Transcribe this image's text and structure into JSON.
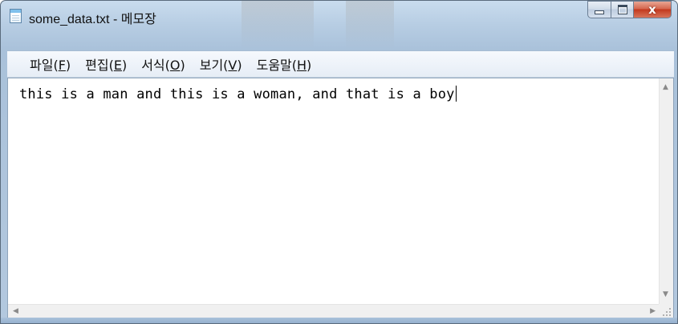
{
  "window": {
    "title": "some_data.txt - 메모장",
    "icon": "notepad-icon",
    "caption_buttons": {
      "minimize_icon": "minimize-icon",
      "maximize_icon": "maximize-icon",
      "close_glyph": "x"
    }
  },
  "menu": {
    "items": [
      {
        "label": "파일(F)"
      },
      {
        "label": "편집(E)"
      },
      {
        "label": "서식(O)"
      },
      {
        "label": "보기(V)"
      },
      {
        "label": "도움말(H)"
      }
    ]
  },
  "editor": {
    "content": "this is a man and this is a woman, and that is a boy"
  },
  "scrollbars": {
    "up_arrow": "▲",
    "down_arrow": "▼",
    "left_arrow": "◀",
    "right_arrow": "▶"
  },
  "colors": {
    "frame": "#b7cde3",
    "close_button": "#c2391e",
    "menubar": "#eef3f9",
    "editor_bg": "#ffffff"
  }
}
